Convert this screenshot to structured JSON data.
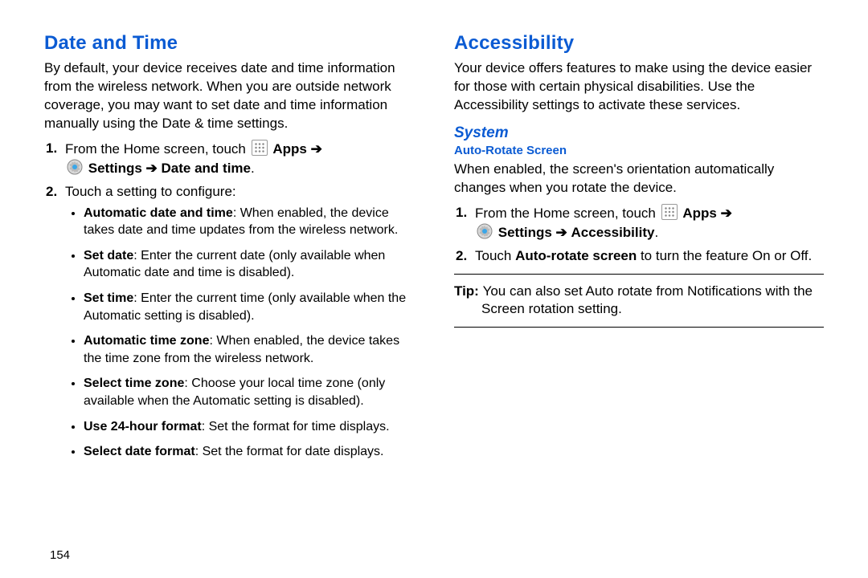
{
  "left": {
    "heading": "Date and Time",
    "intro": "By default, your device receives date and time information from the wireless network. When you are outside network coverage, you may want to set date and time information manually using the Date & time settings.",
    "step1_prefix": "From the Home screen, touch ",
    "apps_label": "Apps",
    "arrow": "➔",
    "settings_label": "Settings",
    "datetime_label": "Date and time",
    "step2_text": "Touch a setting to configure:",
    "bullets": {
      "b0_label": "Automatic date and time",
      "b0_text": ": When enabled, the device takes date and time updates from the wireless network.",
      "b1_label": "Set date",
      "b1_text": ": Enter the current date (only available when Automatic date and time is disabled).",
      "b2_label": "Set time",
      "b2_text": ": Enter the current time (only available when the Automatic setting is disabled).",
      "b3_label": "Automatic time zone",
      "b3_text": ": When enabled, the device takes the time zone from the wireless network.",
      "b4_label": "Select time zone",
      "b4_text": ": Choose your local time zone (only available when the Automatic setting is disabled).",
      "b5_label": "Use 24-hour format",
      "b5_text": ": Set the format for time displays.",
      "b6_label": "Select date format",
      "b6_text": ": Set the format for date displays."
    }
  },
  "right": {
    "heading": "Accessibility",
    "intro": "Your device offers features to make using the device easier for those with certain physical disabilities. Use the Accessibility settings to activate these services.",
    "system_heading": "System",
    "autorotate_heading": "Auto-Rotate Screen",
    "autorotate_intro": "When enabled, the screen's orientation automatically changes when you rotate the device.",
    "step1_prefix": "From the Home screen, touch ",
    "apps_label": "Apps",
    "arrow": "➔",
    "settings_label": "Settings",
    "accessibility_label": "Accessibility",
    "step2_prefix": "Touch ",
    "step2_bold": "Auto-rotate screen",
    "step2_suffix": " to turn the feature On or Off.",
    "tip_label": "Tip: ",
    "tip_text": "You can also set Auto rotate from Notifications with the Screen rotation setting."
  },
  "pagenum": "154"
}
